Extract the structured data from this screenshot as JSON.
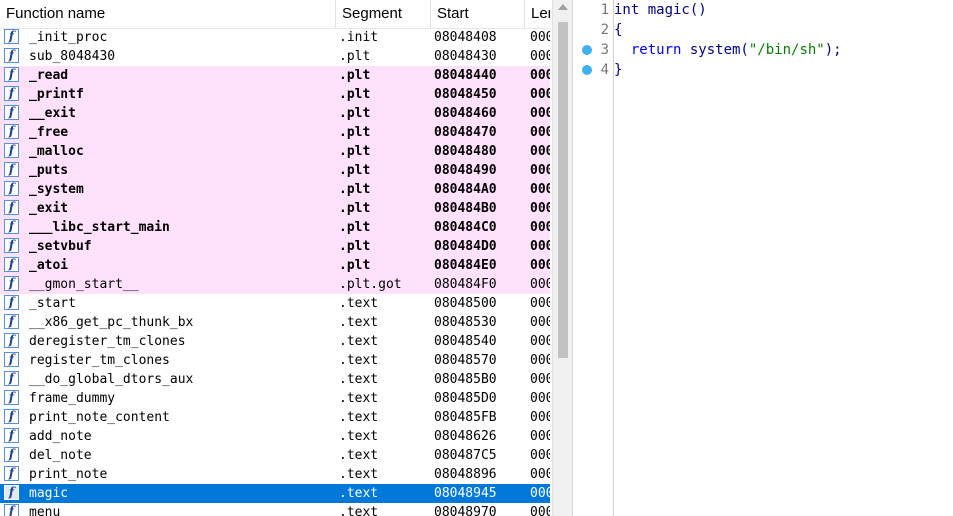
{
  "functions_window": {
    "columns": [
      {
        "key": "name",
        "label": "Function name"
      },
      {
        "key": "segment",
        "label": "Segment"
      },
      {
        "key": "start",
        "label": "Start"
      },
      {
        "key": "length",
        "label": "Ler"
      }
    ],
    "rows": [
      {
        "name": "_init_proc",
        "segment": ".init",
        "start": "08048408",
        "length": "000",
        "kind": "normal"
      },
      {
        "name": "sub_8048430",
        "segment": ".plt",
        "start": "08048430",
        "length": "000",
        "kind": "normal"
      },
      {
        "name": "_read",
        "segment": ".plt",
        "start": "08048440",
        "length": "000",
        "kind": "import"
      },
      {
        "name": "_printf",
        "segment": ".plt",
        "start": "08048450",
        "length": "000",
        "kind": "import"
      },
      {
        "name": "__exit",
        "segment": ".plt",
        "start": "08048460",
        "length": "000",
        "kind": "import"
      },
      {
        "name": "_free",
        "segment": ".plt",
        "start": "08048470",
        "length": "000",
        "kind": "import"
      },
      {
        "name": "_malloc",
        "segment": ".plt",
        "start": "08048480",
        "length": "000",
        "kind": "import"
      },
      {
        "name": "_puts",
        "segment": ".plt",
        "start": "08048490",
        "length": "000",
        "kind": "import"
      },
      {
        "name": "_system",
        "segment": ".plt",
        "start": "080484A0",
        "length": "000",
        "kind": "import"
      },
      {
        "name": "_exit",
        "segment": ".plt",
        "start": "080484B0",
        "length": "000",
        "kind": "import"
      },
      {
        "name": "___libc_start_main",
        "segment": ".plt",
        "start": "080484C0",
        "length": "000",
        "kind": "import"
      },
      {
        "name": "_setvbuf",
        "segment": ".plt",
        "start": "080484D0",
        "length": "000",
        "kind": "import"
      },
      {
        "name": "_atoi",
        "segment": ".plt",
        "start": "080484E0",
        "length": "000",
        "kind": "import"
      },
      {
        "name": "__gmon_start__",
        "segment": ".plt.got",
        "start": "080484F0",
        "length": "000",
        "kind": "import-thin"
      },
      {
        "name": "_start",
        "segment": ".text",
        "start": "08048500",
        "length": "000",
        "kind": "normal"
      },
      {
        "name": "__x86_get_pc_thunk_bx",
        "segment": ".text",
        "start": "08048530",
        "length": "000",
        "kind": "normal"
      },
      {
        "name": "deregister_tm_clones",
        "segment": ".text",
        "start": "08048540",
        "length": "000",
        "kind": "normal"
      },
      {
        "name": "register_tm_clones",
        "segment": ".text",
        "start": "08048570",
        "length": "000",
        "kind": "normal"
      },
      {
        "name": "__do_global_dtors_aux",
        "segment": ".text",
        "start": "080485B0",
        "length": "000",
        "kind": "normal"
      },
      {
        "name": "frame_dummy",
        "segment": ".text",
        "start": "080485D0",
        "length": "000",
        "kind": "normal"
      },
      {
        "name": "print_note_content",
        "segment": ".text",
        "start": "080485FB",
        "length": "000",
        "kind": "normal"
      },
      {
        "name": "add_note",
        "segment": ".text",
        "start": "08048626",
        "length": "000",
        "kind": "normal"
      },
      {
        "name": "del_note",
        "segment": ".text",
        "start": "080487C5",
        "length": "000",
        "kind": "normal"
      },
      {
        "name": "print_note",
        "segment": ".text",
        "start": "08048896",
        "length": "000",
        "kind": "normal"
      },
      {
        "name": "magic",
        "segment": ".text",
        "start": "08048945",
        "length": "000",
        "kind": "selected"
      },
      {
        "name": "menu",
        "segment": ".text",
        "start": "08048970",
        "length": "000",
        "kind": "normal"
      }
    ],
    "icon": "function-icon",
    "icon_glyph": "f",
    "colors": {
      "import_bg": "#ffe1fb",
      "selected_bg": "#0078d7"
    }
  },
  "pseudocode": {
    "lines": [
      {
        "num": "1",
        "breakpoint": false,
        "parts": [
          {
            "t": "int magic()",
            "c": "plain"
          }
        ]
      },
      {
        "num": "2",
        "breakpoint": false,
        "parts": [
          {
            "t": "{",
            "c": "plain"
          }
        ]
      },
      {
        "num": "3",
        "breakpoint": true,
        "parts": [
          {
            "t": "  return ",
            "c": "kw"
          },
          {
            "t": "system(",
            "c": "plain"
          },
          {
            "t": "\"/bin/sh\"",
            "c": "str"
          },
          {
            "t": ");",
            "c": "plain"
          }
        ]
      },
      {
        "num": "4",
        "breakpoint": true,
        "parts": [
          {
            "t": "}",
            "c": "plain"
          }
        ]
      }
    ],
    "breakpoint_icon": "breakpoint-dot-icon",
    "colors": {
      "breakpoint": "#3fb0ef"
    }
  }
}
